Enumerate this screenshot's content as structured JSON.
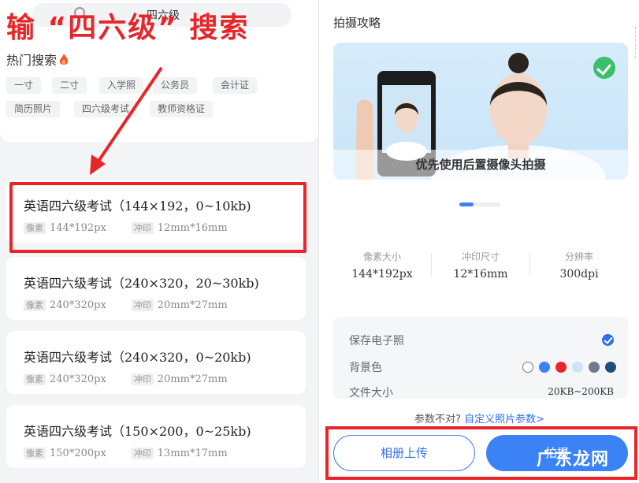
{
  "search": {
    "query": "四六级"
  },
  "overlay_caption": "输 “四六级” 搜索",
  "hot": {
    "title": "热门搜索",
    "tags": [
      "一寸",
      "二寸",
      "入学照",
      "公务员",
      "会计证",
      "简历照片",
      "四六级考试",
      "教师资格证"
    ]
  },
  "results": [
    {
      "title": "英语四六级考试（144×192，0~10kb)",
      "pixel_label": "像素",
      "pixel": "144*192px",
      "print_label": "冲印",
      "print": "12mm*16mm"
    },
    {
      "title": "英语四六级考试（240×320，20~30kb)",
      "pixel_label": "像素",
      "pixel": "240*320px",
      "print_label": "冲印",
      "print": "20mm*27mm"
    },
    {
      "title": "英语四六级考试（240×320，0~20kb)",
      "pixel_label": "像素",
      "pixel": "240*320px",
      "print_label": "冲印",
      "print": "20mm*27mm"
    },
    {
      "title": "英语四六级考试（150×200，0~25kb)",
      "pixel_label": "像素",
      "pixel": "150*200px",
      "print_label": "冲印",
      "print": "13mm*17mm"
    }
  ],
  "detail": {
    "title": "拍摄攻略",
    "hero_caption": "优先使用后置摄像头拍摄",
    "specs": [
      {
        "label": "像素大小",
        "value": "144*192px"
      },
      {
        "label": "冲印尺寸",
        "value": "12*16mm"
      },
      {
        "label": "分辨率",
        "value": "300dpi"
      }
    ],
    "options": {
      "save_label": "保存电子照",
      "bg_label": "背景色",
      "filesize_label": "文件大小",
      "filesize_value": "20KB~200KB",
      "bg_colors": [
        "#ffffff",
        "#3b82f6",
        "#e8262a",
        "#cfe3f5",
        "#6f7a8f",
        "#1f4e79"
      ]
    },
    "hint_text": "参数不对?",
    "hint_link": "自定义照片参数>",
    "album_button": "相册上传",
    "shoot_button": "拍摄",
    "watermark": "广东龙网"
  }
}
